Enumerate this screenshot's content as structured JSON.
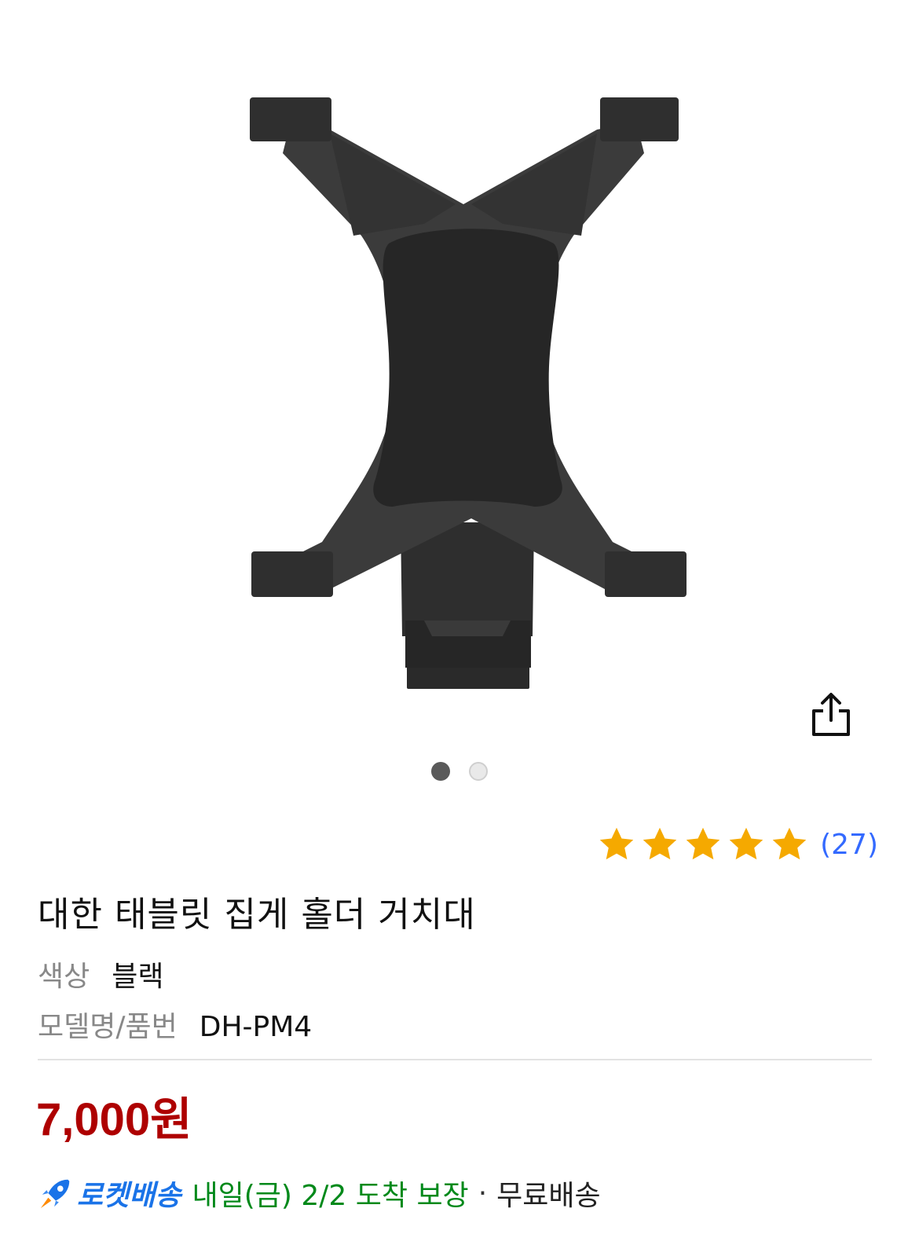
{
  "product": {
    "title": "대한 태블릿 집게 홀더 거치대",
    "image_icon": "tablet-holder-image",
    "share_icon": "share-icon",
    "carousel": {
      "count": 2,
      "active_index": 0
    }
  },
  "rating": {
    "stars": 5,
    "star_color": "#f5a900",
    "review_count": "(27)"
  },
  "specs": {
    "color_label": "색상",
    "color_value": "블랙",
    "model_label": "모델명/품번",
    "model_value": "DH-PM4"
  },
  "price": {
    "text": "7,000원",
    "color": "#ae0000"
  },
  "delivery": {
    "rocket_label": "로켓배송",
    "arrival": "내일(금) 2/2 도착 보장",
    "separator": "·",
    "free_shipping": "무료배송",
    "rocket_color": "#1a73e8",
    "arrival_color": "#00891a"
  }
}
